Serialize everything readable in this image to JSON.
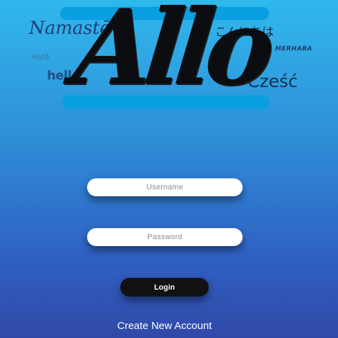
{
  "logo": {
    "wordmark": "Allo",
    "greetings": {
      "namaste": "Namastē",
      "hola": "Hallå",
      "hello": "hello",
      "konnichiwa": "こんにちは",
      "merhaba": "MERHABA",
      "czesc": "Cześć"
    },
    "accent_color": "#0a9fe0"
  },
  "form": {
    "username_placeholder": "Username",
    "password_placeholder": "Password",
    "login_label": "Login",
    "create_account_label": "Create New Account"
  },
  "colors": {
    "background_top": "#30b8ec",
    "background_bottom": "#3049a8",
    "button": "#121214"
  }
}
